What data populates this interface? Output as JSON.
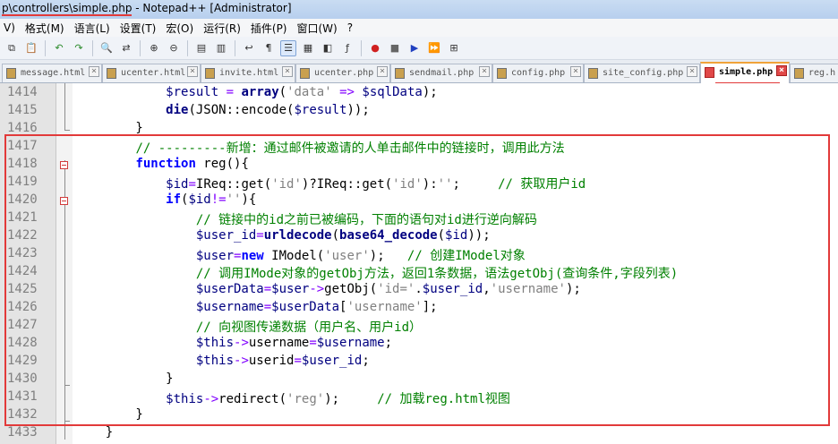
{
  "window": {
    "title_path": "p\\controllers\\simple.php",
    "title_rest": " - Notepad++ [Administrator]"
  },
  "menu": [
    "V)",
    "格式(M)",
    "语言(L)",
    "设置(T)",
    "宏(O)",
    "运行(R)",
    "插件(P)",
    "窗口(W)",
    "?"
  ],
  "tabs": [
    {
      "label": "message.html",
      "active": false
    },
    {
      "label": "ucenter.html",
      "active": false
    },
    {
      "label": "invite.html",
      "active": false
    },
    {
      "label": "ucenter.php",
      "active": false
    },
    {
      "label": "sendmail.php",
      "active": false
    },
    {
      "label": "config.php",
      "active": false
    },
    {
      "label": "site_config.php",
      "active": false
    },
    {
      "label": "simple.php",
      "active": true
    },
    {
      "label": "reg.h",
      "active": false
    }
  ],
  "colors": {
    "highlight_box": "#e23a3a",
    "comment": "#008000",
    "keyword": "#0000ff"
  },
  "editor": {
    "lines": [
      {
        "num": "1414",
        "code": [
          {
            "t": "            "
          },
          {
            "t": "$result",
            "c": "var"
          },
          {
            "t": " "
          },
          {
            "t": "=",
            "c": "op"
          },
          {
            "t": " "
          },
          {
            "t": "array",
            "c": "fn"
          },
          {
            "t": "("
          },
          {
            "t": "'data'",
            "c": "str"
          },
          {
            "t": " "
          },
          {
            "t": "=>",
            "c": "op"
          },
          {
            "t": " "
          },
          {
            "t": "$sqlData",
            "c": "var"
          },
          {
            "t": ");"
          }
        ]
      },
      {
        "num": "1415",
        "code": [
          {
            "t": "            "
          },
          {
            "t": "die",
            "c": "fn"
          },
          {
            "t": "(JSON::encode("
          },
          {
            "t": "$result",
            "c": "var"
          },
          {
            "t": "));"
          }
        ]
      },
      {
        "num": "1416",
        "code": [
          {
            "t": "        }"
          }
        ]
      },
      {
        "num": "1417",
        "code": [
          {
            "t": "        "
          },
          {
            "t": "// ---------新增：通过邮件被邀请的人单击邮件中的链接时，调用此方法",
            "c": "cm"
          }
        ]
      },
      {
        "num": "1418",
        "code": [
          {
            "t": "        "
          },
          {
            "t": "function",
            "c": "kw"
          },
          {
            "t": " reg(){"
          }
        ]
      },
      {
        "num": "1419",
        "code": [
          {
            "t": "            "
          },
          {
            "t": "$id",
            "c": "var"
          },
          {
            "t": "=",
            "c": "op"
          },
          {
            "t": "IReq::get("
          },
          {
            "t": "'id'",
            "c": "str"
          },
          {
            "t": ")?IReq::get("
          },
          {
            "t": "'id'",
            "c": "str"
          },
          {
            "t": "):"
          },
          {
            "t": "''",
            "c": "str"
          },
          {
            "t": ";     "
          },
          {
            "t": "// 获取用户id",
            "c": "cm"
          }
        ]
      },
      {
        "num": "1420",
        "code": [
          {
            "t": "            "
          },
          {
            "t": "if",
            "c": "kw"
          },
          {
            "t": "("
          },
          {
            "t": "$id",
            "c": "var"
          },
          {
            "t": "!=",
            "c": "op"
          },
          {
            "t": "''",
            "c": "str"
          },
          {
            "t": "){"
          }
        ]
      },
      {
        "num": "1421",
        "code": [
          {
            "t": "                "
          },
          {
            "t": "// 链接中的id之前已被编码，下面的语句对id进行逆向解码",
            "c": "cm"
          }
        ]
      },
      {
        "num": "1422",
        "code": [
          {
            "t": "                "
          },
          {
            "t": "$user_id",
            "c": "var"
          },
          {
            "t": "=",
            "c": "op"
          },
          {
            "t": "urldecode",
            "c": "fn"
          },
          {
            "t": "("
          },
          {
            "t": "base64_decode",
            "c": "fn"
          },
          {
            "t": "("
          },
          {
            "t": "$id",
            "c": "var"
          },
          {
            "t": "));"
          }
        ]
      },
      {
        "num": "1423",
        "code": [
          {
            "t": "                "
          },
          {
            "t": "$user",
            "c": "var"
          },
          {
            "t": "=",
            "c": "op"
          },
          {
            "t": "new",
            "c": "kw"
          },
          {
            "t": " IModel("
          },
          {
            "t": "'user'",
            "c": "str"
          },
          {
            "t": ");   "
          },
          {
            "t": "// 创建IModel对象",
            "c": "cm"
          }
        ]
      },
      {
        "num": "1424",
        "code": [
          {
            "t": "                "
          },
          {
            "t": "// 调用IMode对象的getObj方法，返回1条数据，语法getObj(查询条件,字段列表)",
            "c": "cm"
          }
        ]
      },
      {
        "num": "1425",
        "code": [
          {
            "t": "                "
          },
          {
            "t": "$userData",
            "c": "var"
          },
          {
            "t": "=",
            "c": "op"
          },
          {
            "t": "$user",
            "c": "var"
          },
          {
            "t": "->",
            "c": "op"
          },
          {
            "t": "getObj("
          },
          {
            "t": "'id='",
            "c": "str"
          },
          {
            "t": "."
          },
          {
            "t": "$user_id",
            "c": "var"
          },
          {
            "t": ","
          },
          {
            "t": "'username'",
            "c": "str"
          },
          {
            "t": ");"
          }
        ]
      },
      {
        "num": "1426",
        "code": [
          {
            "t": "                "
          },
          {
            "t": "$username",
            "c": "var"
          },
          {
            "t": "=",
            "c": "op"
          },
          {
            "t": "$userData",
            "c": "var"
          },
          {
            "t": "["
          },
          {
            "t": "'username'",
            "c": "str"
          },
          {
            "t": "];"
          }
        ]
      },
      {
        "num": "1427",
        "code": [
          {
            "t": "                "
          },
          {
            "t": "// 向视图传递数据（用户名、用户id）",
            "c": "cm"
          }
        ]
      },
      {
        "num": "1428",
        "code": [
          {
            "t": "                "
          },
          {
            "t": "$this",
            "c": "var"
          },
          {
            "t": "->",
            "c": "op"
          },
          {
            "t": "username"
          },
          {
            "t": "=",
            "c": "op"
          },
          {
            "t": "$username",
            "c": "var"
          },
          {
            "t": ";"
          }
        ]
      },
      {
        "num": "1429",
        "code": [
          {
            "t": "                "
          },
          {
            "t": "$this",
            "c": "var"
          },
          {
            "t": "->",
            "c": "op"
          },
          {
            "t": "userid"
          },
          {
            "t": "=",
            "c": "op"
          },
          {
            "t": "$user_id",
            "c": "var"
          },
          {
            "t": ";"
          }
        ]
      },
      {
        "num": "1430",
        "code": [
          {
            "t": "            }"
          }
        ]
      },
      {
        "num": "1431",
        "code": [
          {
            "t": "            "
          },
          {
            "t": "$this",
            "c": "var"
          },
          {
            "t": "->",
            "c": "op"
          },
          {
            "t": "redirect("
          },
          {
            "t": "'reg'",
            "c": "str"
          },
          {
            "t": ");     "
          },
          {
            "t": "// 加载reg.html视图",
            "c": "cm"
          }
        ]
      },
      {
        "num": "1432",
        "code": [
          {
            "t": "        }"
          }
        ]
      },
      {
        "num": "1433",
        "code": [
          {
            "t": "    }"
          }
        ]
      }
    ]
  }
}
